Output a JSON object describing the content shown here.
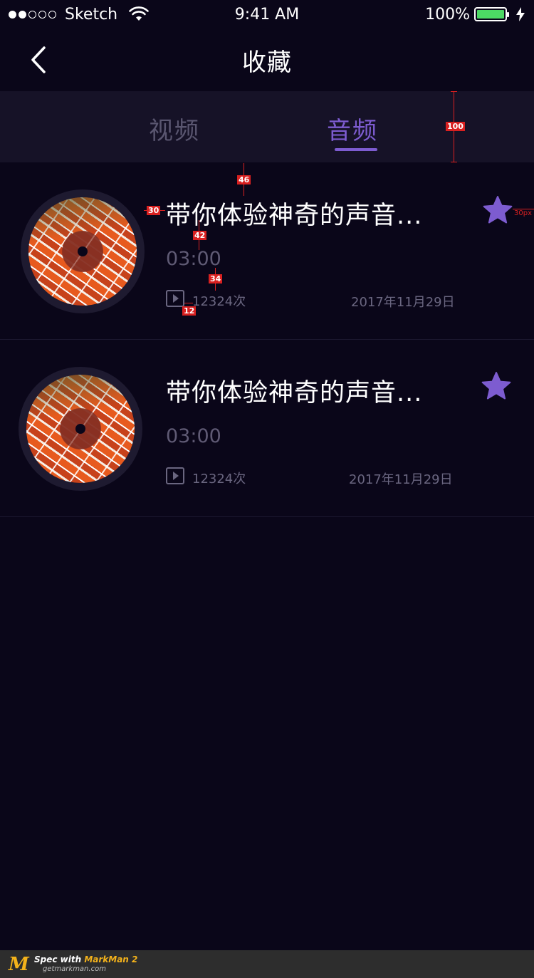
{
  "status_bar": {
    "carrier": "Sketch",
    "time": "9:41 AM",
    "battery_percent": "100%",
    "battery_level": 1.0,
    "battery_color": "#4cd964"
  },
  "nav": {
    "title": "收藏",
    "back_icon": "chevron-left-icon"
  },
  "tabs": [
    {
      "label": "视频",
      "active": false
    },
    {
      "label": "音频",
      "active": true
    }
  ],
  "accent_color": "#7d5cd0",
  "audio_items": [
    {
      "title": "带你体验神奇的声音...",
      "duration": "03:00",
      "play_count": "12324次",
      "date": "2017年11月29日",
      "favorited": true
    },
    {
      "title": "带你体验神奇的声音...",
      "duration": "03:00",
      "play_count": "12324次",
      "date": "2017年11月29日",
      "favorited": true
    }
  ],
  "annotations": {
    "tab_height": "100",
    "title_top_gap": "46",
    "title_left_gap": "30",
    "title_duration_gap": "42",
    "duration_meta_gap": "34",
    "icon_count_gap": "12",
    "star_right_gap": "30px"
  },
  "markman": {
    "spec_prefix": "Spec with ",
    "brand": "MarkMan 2",
    "url": "getmarkman.com"
  }
}
